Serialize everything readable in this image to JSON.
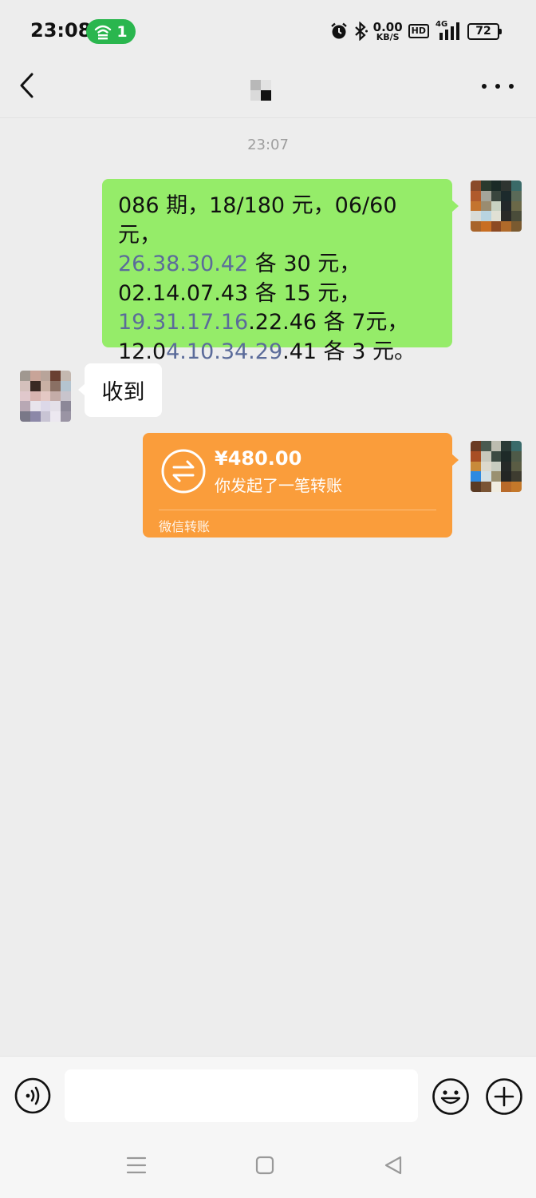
{
  "status_bar": {
    "time": "23:08",
    "hotspot_count": "1",
    "net_speed_value": "0.00",
    "net_speed_unit": "KB/S",
    "hd_label": "HD",
    "signal_label": "4G",
    "battery": "72",
    "icons": [
      "alarm-icon",
      "bluetooth-icon",
      "signal-icon"
    ]
  },
  "header": {
    "back_icon": "chevron-left-icon",
    "more_icon": "more-dots-icon"
  },
  "chat": {
    "timestamp": "23:07",
    "messages": [
      {
        "side": "right",
        "type": "text",
        "lines": [
          {
            "plain": "086 期，18/180 元，06/60 元，"
          },
          {
            "link": "26.38.30.42",
            "rest": " 各 30 元，"
          },
          {
            "plain": "02.14.07.43 各 15 元，"
          },
          {
            "link": "19.31.17.16",
            "rest": ".22.46 各 7元，"
          },
          {
            "pre": "12.0",
            "link": "4.10.34.29",
            "rest": ".41 各 3 元。"
          }
        ]
      },
      {
        "side": "left",
        "type": "text",
        "text": "收到"
      },
      {
        "side": "right",
        "type": "transfer",
        "amount": "¥480.00",
        "description": "你发起了一笔转账",
        "label": "微信转账",
        "icon": "transfer-arrows-icon"
      }
    ]
  },
  "input_bar": {
    "value": "",
    "icons": [
      "voice-icon",
      "emoji-icon",
      "plus-icon"
    ]
  },
  "nav_bar": {
    "icons": [
      "menu-lines-icon",
      "home-square-icon",
      "back-triangle-icon"
    ]
  },
  "colors": {
    "background": "#ededed",
    "sent_bubble": "#95ec69",
    "received_bubble": "#ffffff",
    "transfer_card": "#fa9d3b",
    "hotspot_badge": "#2ab64e",
    "number_link": "#5b6b9a"
  }
}
